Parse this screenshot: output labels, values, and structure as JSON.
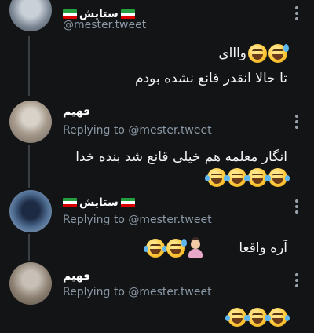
{
  "tweets": [
    {
      "name": "ستایش",
      "handle": "@mester.tweet",
      "lines": [
        "وااای",
        "تا حالا انقدر قانع نشده بودم"
      ],
      "emojis": [
        "grin-sweat",
        "grin"
      ]
    },
    {
      "name": "فهیم",
      "reply": "Replying to @mester.tweet",
      "lines": [
        "انگار معلمه هم خیلی قانع شد بنده خدا"
      ],
      "emojis": [
        "tears",
        "tears",
        "tears",
        "tears"
      ]
    },
    {
      "name": "ستایش",
      "reply": "Replying to @mester.tweet",
      "lines": [
        "آره واقعا"
      ],
      "emojis": [
        "person-facepalm",
        "grin-sweat",
        "tears"
      ]
    },
    {
      "name": "فهیم",
      "reply": "Replying to @mester.tweet",
      "lines": [],
      "emojis": [
        "tears",
        "tears",
        "tears"
      ]
    }
  ],
  "flag_colors": [
    "#239f40",
    "#ffffff",
    "#da0000"
  ],
  "icons": [
    "more-vertical-icon",
    "iran-flag-icon"
  ]
}
